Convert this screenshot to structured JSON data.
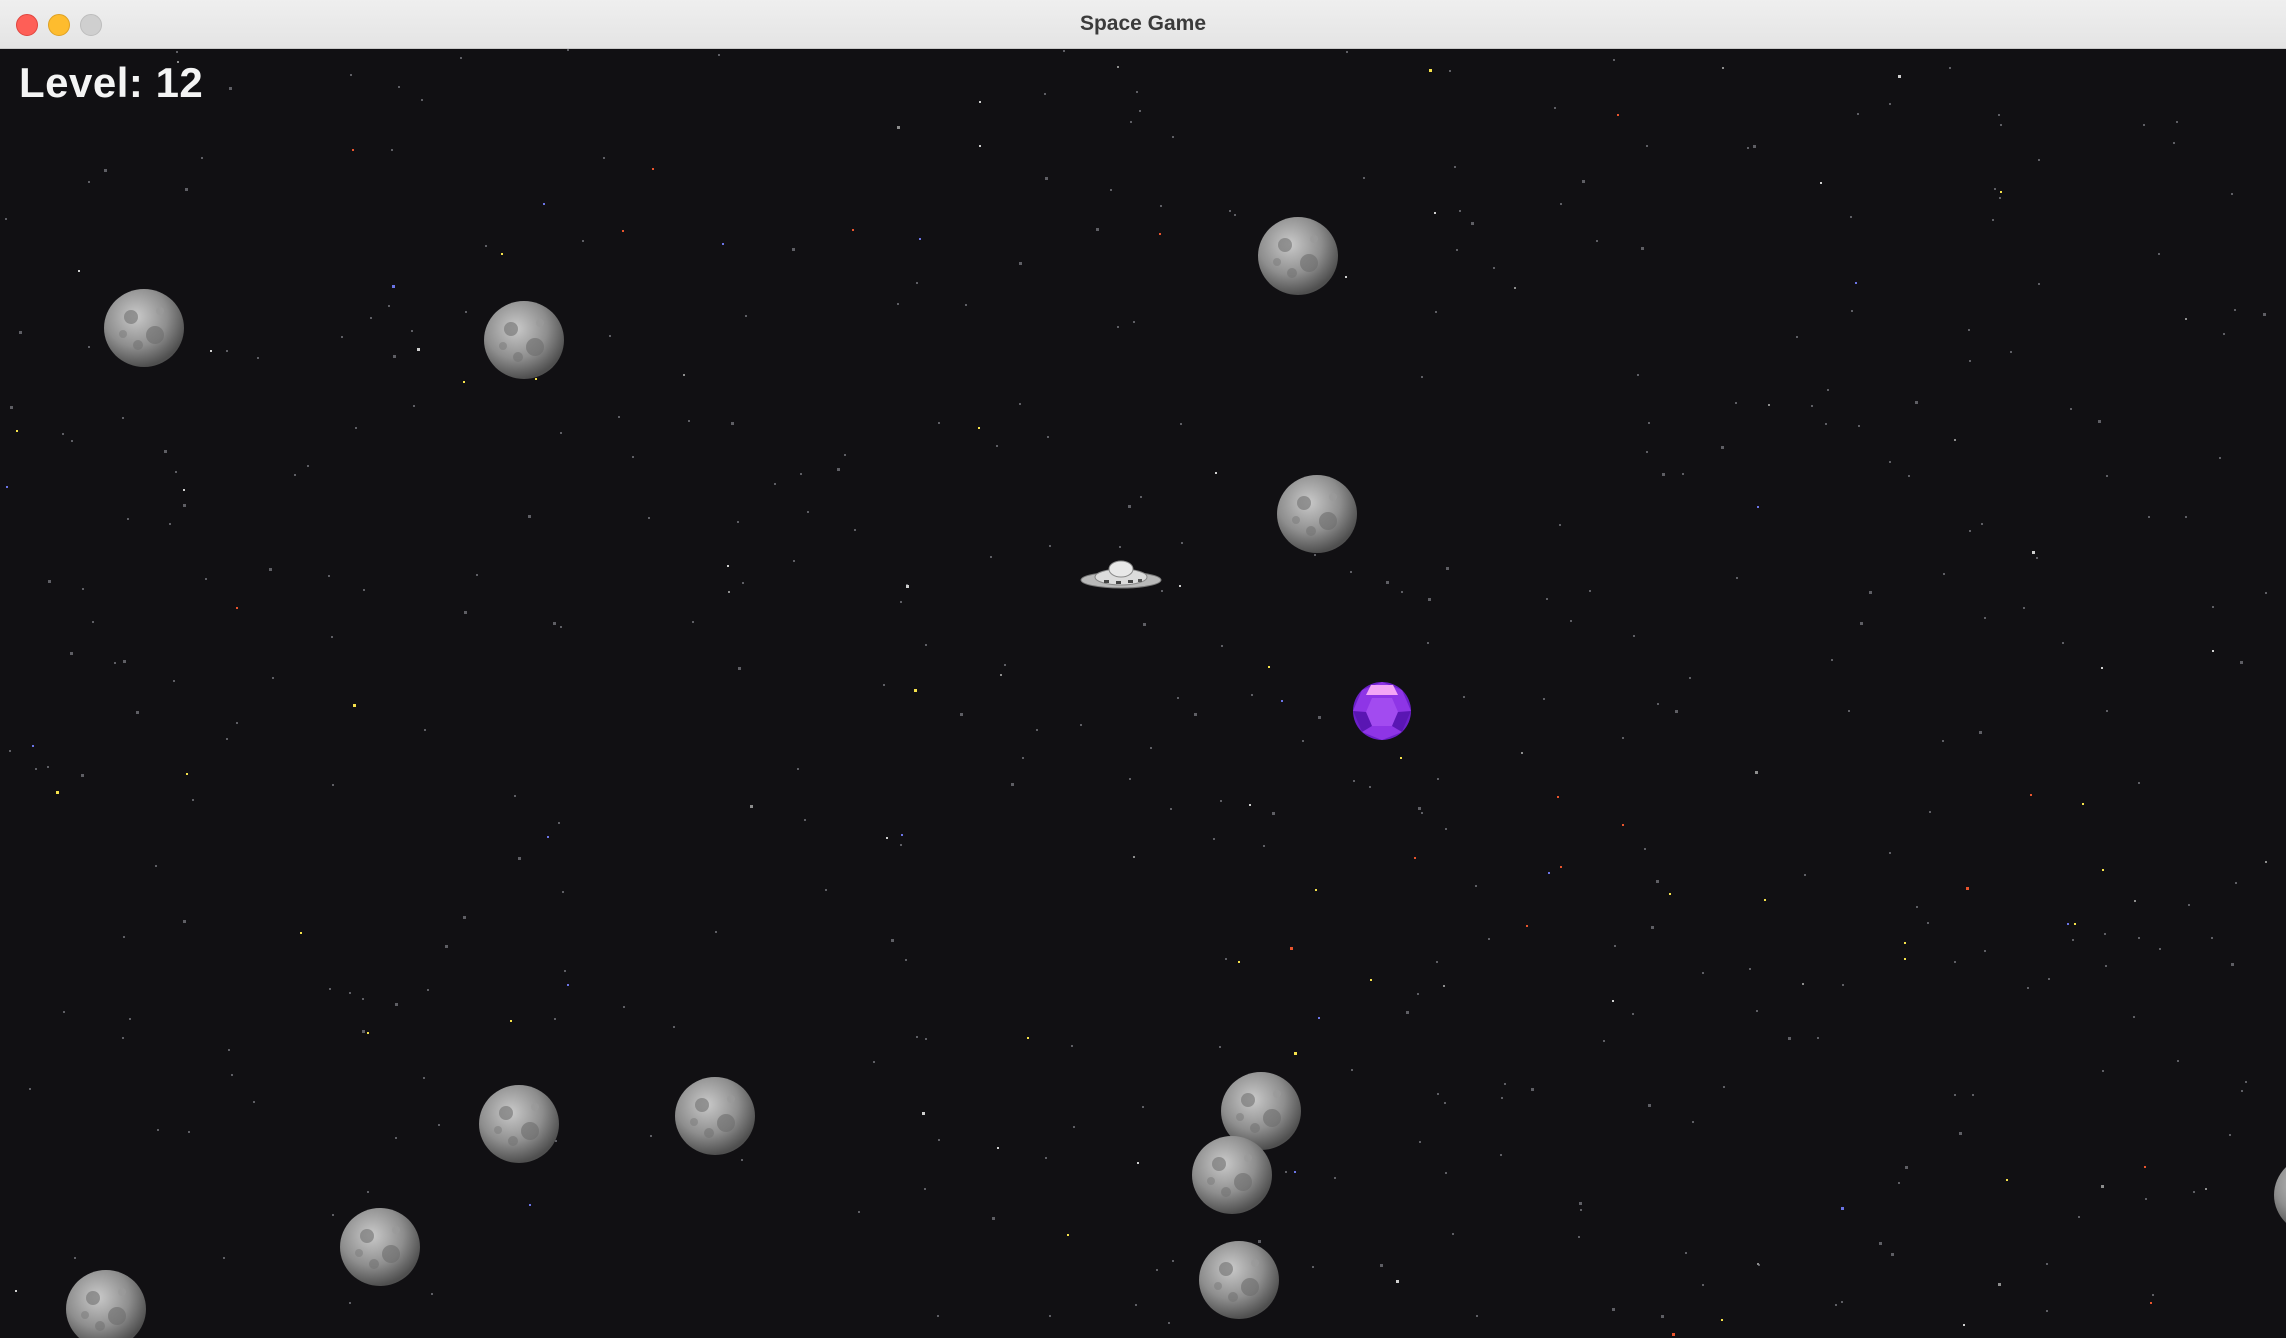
{
  "window": {
    "title": "Space Game"
  },
  "hud": {
    "level_label": "Level:",
    "level_value": "12"
  },
  "icons": {
    "close": "close-traffic-light",
    "minimize": "minimize-traffic-light",
    "maximize": "maximize-traffic-light",
    "player": "ufo-spaceship-icon",
    "pickup": "purple-gem-icon",
    "obstacle": "asteroid-icon"
  },
  "colors": {
    "background": "#111013",
    "gem": "#8a2be2",
    "asteroid": "#8c8c8c",
    "hud_text": "#f4f4f4"
  }
}
